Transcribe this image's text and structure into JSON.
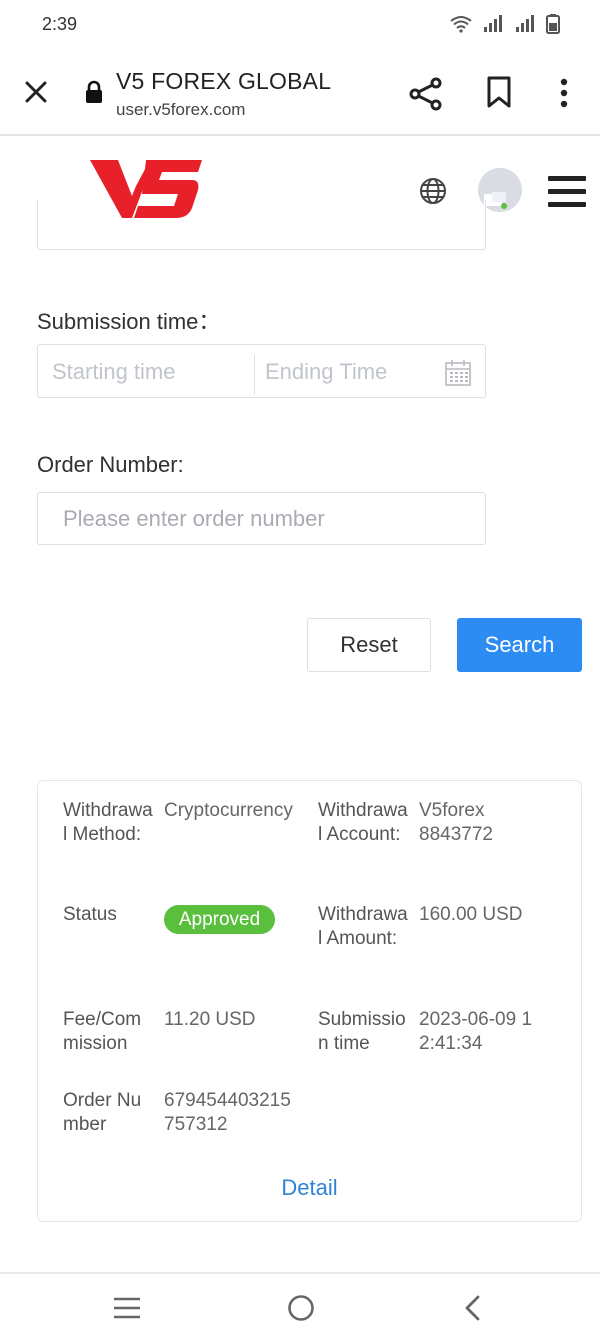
{
  "status_bar": {
    "time": "2:39"
  },
  "browser": {
    "title": "V5 FOREX GLOBAL",
    "url": "user.v5forex.com"
  },
  "site": {
    "logo_text": "V5",
    "brand_color": "#e8202a"
  },
  "filters": {
    "submission_time_label": "Submission time：",
    "start_placeholder": "Starting time",
    "end_placeholder": "Ending Time",
    "order_number_label": "Order Number:",
    "order_number_placeholder": "Please enter order number"
  },
  "buttons": {
    "reset": "Reset",
    "search": "Search"
  },
  "record": {
    "withdrawal_method_label": "Withdrawal Method:",
    "withdrawal_method_value": "Cryptocurrency",
    "withdrawal_account_label": "Withdrawal Account:",
    "withdrawal_account_value": "V5forex 8843772",
    "status_label": "Status",
    "status_value": "Approved",
    "withdrawal_amount_label": "Withdrawal Amount:",
    "withdrawal_amount_value": "160.00 USD",
    "fee_label": "Fee/Commission",
    "fee_value": "11.20 USD",
    "submission_time_label": "Submission time",
    "submission_time_value": "2023-06-09 12:41:34",
    "order_number_label": "Order Number",
    "order_number_value": "679454403215757312",
    "detail_link": "Detail"
  },
  "colors": {
    "primary": "#2c8cf4",
    "success": "#5bbf3e",
    "link": "#2f84d8"
  }
}
